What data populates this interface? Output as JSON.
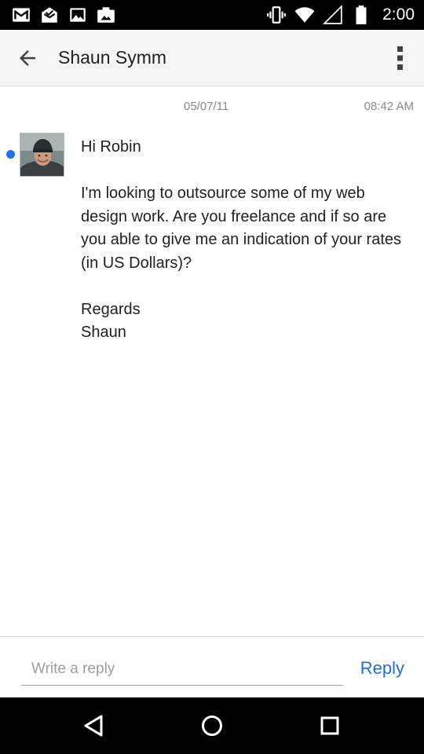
{
  "status_bar": {
    "time": "2:00",
    "left_icons": [
      "gmail-icon",
      "inbox-icon",
      "image-icon",
      "photos-icon"
    ],
    "right_icons": [
      "vibrate-icon",
      "wifi-icon",
      "cell-signal-icon",
      "battery-icon"
    ]
  },
  "app_bar": {
    "title": "Shaun Symm",
    "back_icon": "arrow-back-icon",
    "menu_icon": "more-vert-icon"
  },
  "message": {
    "date": "05/07/11",
    "time": "08:42 AM",
    "unread": true,
    "paragraphs": [
      "Hi Robin",
      "I'm looking to outsource some of my web design work. Are you freelance and if so are you able to give me an indication of your rates (in US Dollars)?",
      "Regards\nShaun"
    ]
  },
  "reply": {
    "placeholder": "Write a reply",
    "value": "",
    "button_label": "Reply"
  },
  "nav_bar": {
    "icons": [
      "back-triangle-icon",
      "home-circle-icon",
      "recents-square-icon"
    ]
  },
  "colors": {
    "accent": "#1e6fcf",
    "unread_dot": "#1a73e8",
    "app_bar_bg": "#f5f5f5",
    "system_bars": "#000000"
  }
}
